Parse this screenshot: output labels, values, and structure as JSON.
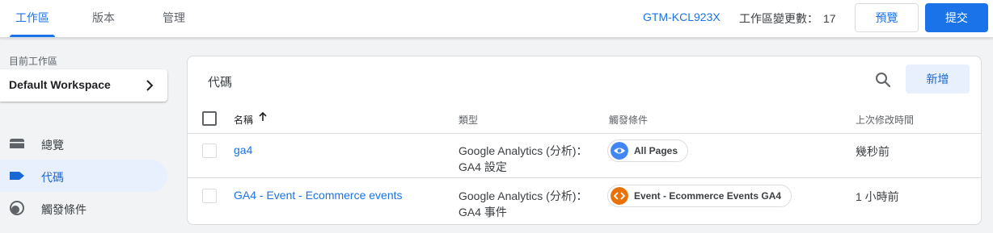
{
  "header": {
    "tabs": [
      {
        "label": "工作區"
      },
      {
        "label": "版本"
      },
      {
        "label": "管理"
      }
    ],
    "container_id": "GTM-KCL923X",
    "changes_label": "工作區變更數：",
    "changes_count": "17",
    "preview_label": "預覽",
    "submit_label": "提交"
  },
  "sidebar": {
    "workspace_label": "目前工作區",
    "workspace_name": "Default Workspace",
    "items": [
      {
        "label": "總覽",
        "icon": "overview-icon"
      },
      {
        "label": "代碼",
        "icon": "tag-icon"
      },
      {
        "label": "觸發條件",
        "icon": "trigger-icon"
      }
    ]
  },
  "main": {
    "title": "代碼",
    "new_label": "新增",
    "columns": [
      "名稱",
      "類型",
      "觸發條件",
      "上次修改時間"
    ],
    "rows": [
      {
        "name": "ga4",
        "type_line1": "Google Analytics (分析)：",
        "type_line2": "GA4 設定",
        "trigger": "All Pages",
        "trigger_icon": "eye-icon",
        "modified": "幾秒前"
      },
      {
        "name": "GA4 - Event - Ecommerce events",
        "type_line1": "Google Analytics (分析)：",
        "type_line2": "GA4 事件",
        "trigger": "Event - Ecommerce Events GA4",
        "trigger_icon": "code-icon",
        "modified": "1 小時前"
      }
    ]
  },
  "colors": {
    "accent": "#1a73e8",
    "active_bg": "#e8f0fe",
    "eye_chip": "#4285f4",
    "code_chip": "#e8710a"
  }
}
